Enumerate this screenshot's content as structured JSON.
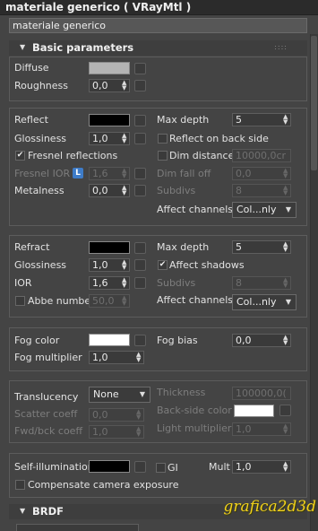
{
  "window": {
    "title": "materiale generico  ( VRayMtl )"
  },
  "material_name": "materiale generico",
  "rollout": {
    "title": "Basic parameters",
    "grip": "::::"
  },
  "diffuse": {
    "label": "Diffuse",
    "color": "#b4b4b4"
  },
  "roughness": {
    "label": "Roughness",
    "value": "0,0"
  },
  "reflect": {
    "label": "Reflect",
    "color": "#000000",
    "glossiness_label": "Glossiness",
    "glossiness": "1,0",
    "fresnel_label": "Fresnel reflections",
    "fresnel_checked": "✔",
    "fresnel_ior_label": "Fresnel IOR",
    "fresnel_ior_lock": "L",
    "fresnel_ior": "1,6",
    "metalness_label": "Metalness",
    "metalness": "0,0",
    "max_depth_label": "Max depth",
    "max_depth": "5",
    "reflect_backside_label": "Reflect on back side",
    "dim_distance_label": "Dim distance",
    "dim_distance": "10000,0cr",
    "dim_falloff_label": "Dim fall off",
    "dim_falloff": "0,0",
    "subdivs_label": "Subdivs",
    "subdivs": "8",
    "affect_channels_label": "Affect channels",
    "affect_channels": "Col...nly"
  },
  "refract": {
    "label": "Refract",
    "color": "#000000",
    "glossiness_label": "Glossiness",
    "glossiness": "1,0",
    "ior_label": "IOR",
    "ior": "1,6",
    "abbe_label": "Abbe number",
    "abbe": "50,0",
    "max_depth_label": "Max depth",
    "max_depth": "5",
    "affect_shadows_label": "Affect shadows",
    "affect_shadows_checked": "✔",
    "subdivs_label": "Subdivs",
    "subdivs": "8",
    "affect_channels_label": "Affect channels",
    "affect_channels": "Col...nly"
  },
  "fog": {
    "color_label": "Fog color",
    "color": "#ffffff",
    "multiplier_label": "Fog multiplier",
    "multiplier": "1,0",
    "bias_label": "Fog bias",
    "bias": "0,0"
  },
  "translucency": {
    "label": "Translucency",
    "mode": "None",
    "scatter_label": "Scatter coeff",
    "scatter": "0,0",
    "fwd_label": "Fwd/bck coeff",
    "fwd": "1,0",
    "thickness_label": "Thickness",
    "thickness": "100000,0(",
    "backside_color_label": "Back-side color",
    "backside_color": "#ffffff",
    "light_mult_label": "Light multiplier",
    "light_mult": "1,0"
  },
  "self_illumination": {
    "label": "Self-illumination",
    "color": "#000000",
    "gi_label": "GI",
    "mult_label": "Mult",
    "mult": "1,0",
    "compensate_label": "Compensate camera exposure"
  },
  "brdf": {
    "title": "BRDF"
  },
  "logo": {
    "text": "grafica2d3d"
  }
}
